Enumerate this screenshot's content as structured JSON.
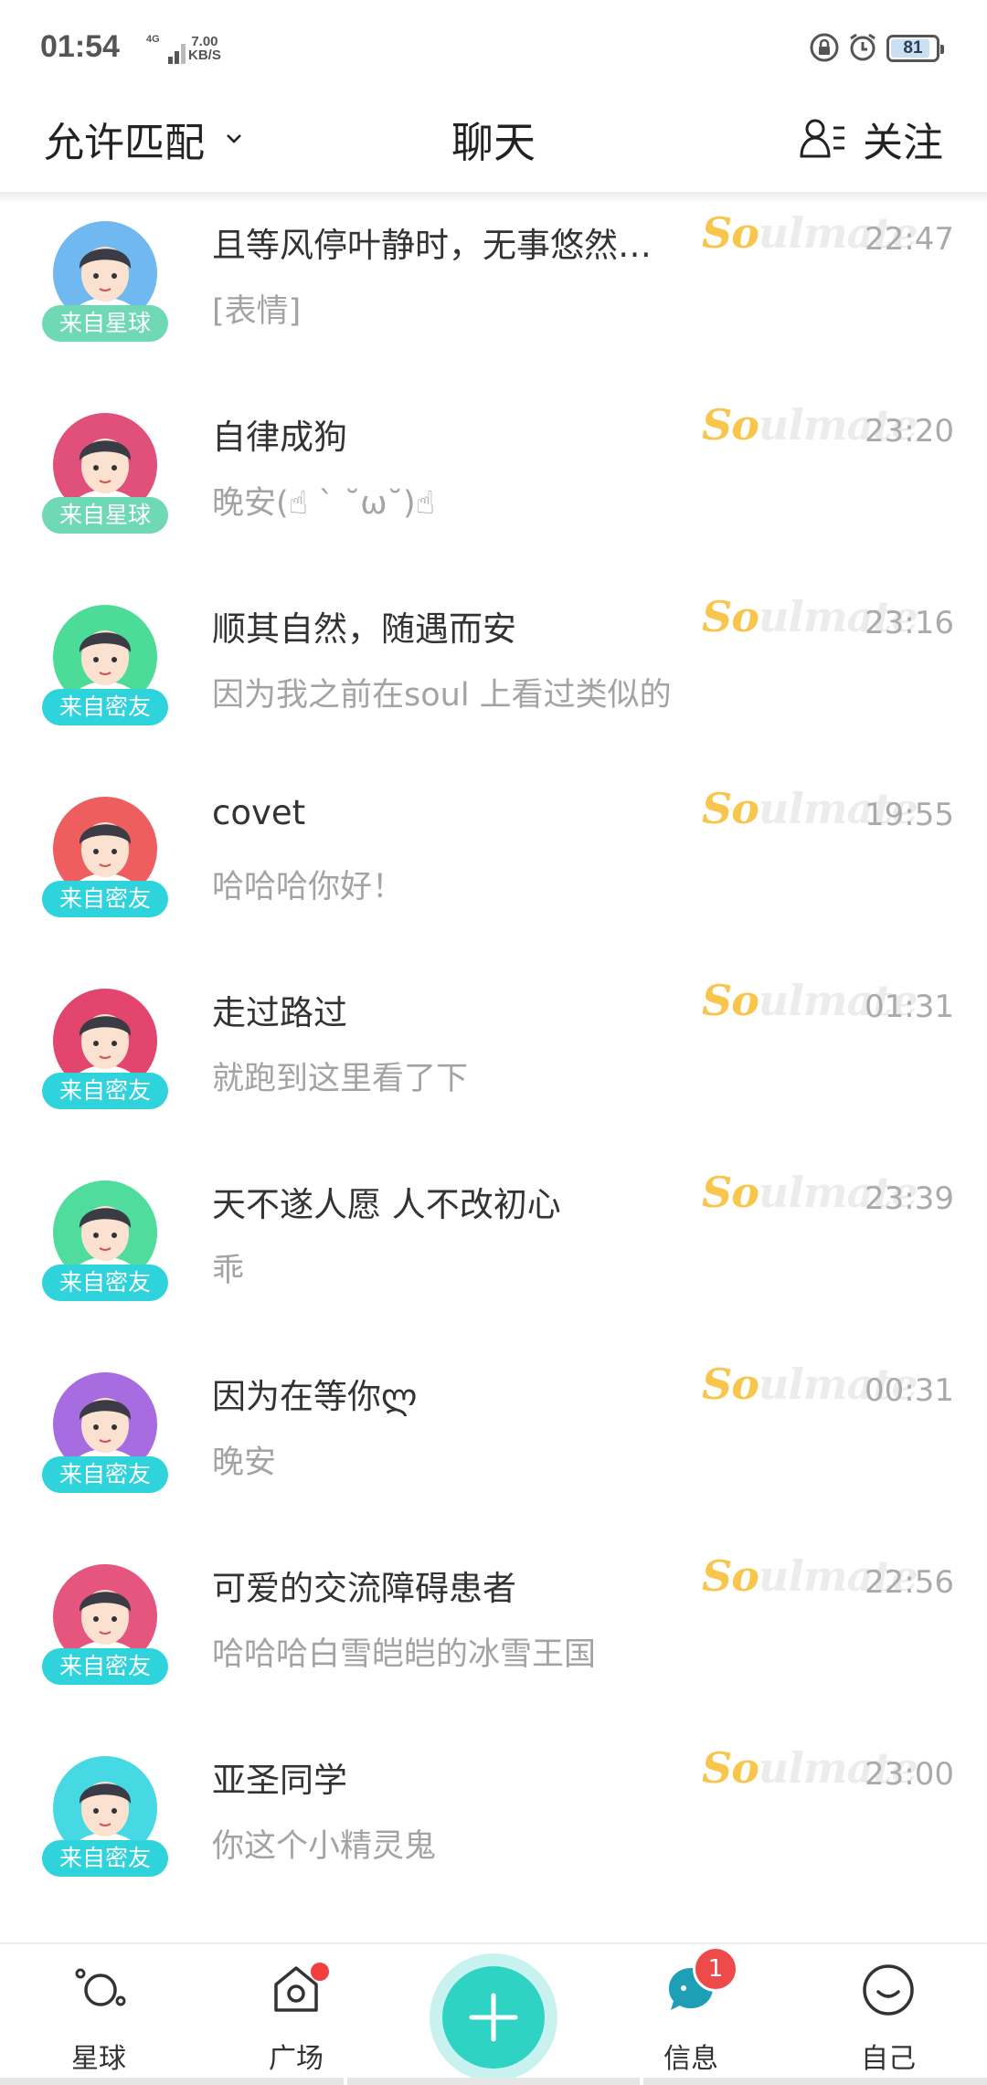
{
  "status_bar": {
    "time": "01:54",
    "network": "4G",
    "speed_value": "7.00",
    "speed_unit": "KB/S",
    "battery": "81"
  },
  "header": {
    "match_label": "允许匹配",
    "title": "聊天",
    "follow_label": "关注"
  },
  "chats": [
    {
      "name": "且等风停叶静时，无事悠然…",
      "message": "[表情]",
      "time": "22:47",
      "source": "来自星球",
      "badge_color": "#6fd9b6",
      "avatar_bg": "#6fb8f0"
    },
    {
      "name": "自律成狗",
      "message": "晚安(☝ ˋ ˘ω˘)☝",
      "time": "23:20",
      "source": "来自星球",
      "badge_color": "#6fd9b6",
      "avatar_bg": "#e0507a"
    },
    {
      "name": "顺其自然，随遇而安",
      "message": "因为我之前在soul 上看过类似的",
      "time": "23:16",
      "source": "来自密友",
      "badge_color": "#2fd3dc",
      "avatar_bg": "#4ddc98"
    },
    {
      "name": "covet",
      "message": "哈哈哈你好！",
      "time": "19:55",
      "source": "来自密友",
      "badge_color": "#2fd3dc",
      "avatar_bg": "#ef5e5e"
    },
    {
      "name": "走过路过",
      "message": "就跑到这里看了下",
      "time": "01:31",
      "source": "来自密友",
      "badge_color": "#2fd3dc",
      "avatar_bg": "#e2466e"
    },
    {
      "name": "天不遂人愿 人不改初心",
      "message": "乖",
      "time": "23:39",
      "source": "来自密友",
      "badge_color": "#2fd3dc",
      "avatar_bg": "#4fdc9c"
    },
    {
      "name": "因为在等你ლ",
      "message": "晚安",
      "time": "00:31",
      "source": "来自密友",
      "badge_color": "#2fd3dc",
      "avatar_bg": "#a76cdf"
    },
    {
      "name": "可爱的交流障碍患者",
      "message": "哈哈哈白雪皑皑的冰雪王国",
      "time": "22:56",
      "source": "来自密友",
      "badge_color": "#2fd3dc",
      "avatar_bg": "#e5557e"
    },
    {
      "name": "亚圣同学",
      "message": "你这个小精灵鬼",
      "time": "23:00",
      "source": "来自密友",
      "badge_color": "#2fd3dc",
      "avatar_bg": "#46d9e3"
    }
  ],
  "soulmate_tag": {
    "first": "So",
    "rest": "ulmate"
  },
  "bottom_nav": {
    "items": [
      {
        "label": "星球",
        "icon": "planet-icon"
      },
      {
        "label": "广场",
        "icon": "square-camera-icon"
      },
      {
        "label": "",
        "icon": "plus-icon"
      },
      {
        "label": "信息",
        "icon": "message-icon"
      },
      {
        "label": "自己",
        "icon": "smile-icon"
      }
    ],
    "message_badge": "1",
    "accent": "#2fd3c3"
  }
}
